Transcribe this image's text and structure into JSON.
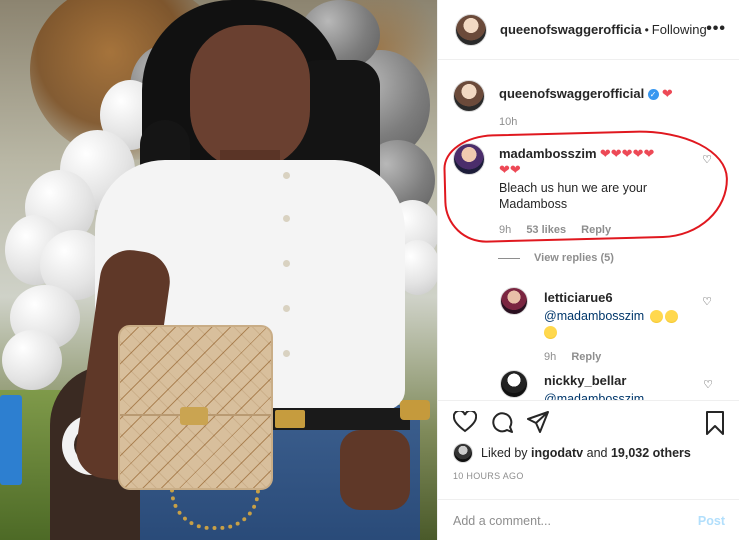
{
  "header": {
    "username": "queenofswaggerofficial",
    "username_display": "queenofswaggerofficia",
    "separator": "•",
    "follow_status": "Following",
    "more_icon": "more-horizontal-icon"
  },
  "caption": {
    "username": "queenofswaggerofficial",
    "verified": true,
    "text": "❤",
    "time": "10h"
  },
  "comments": [
    {
      "username": "madambosszim",
      "text_hearts_line1": "❤❤❤❤❤",
      "text_hearts_line2": "❤❤",
      "text": "Bleach us hun we are your Madamboss",
      "time": "9h",
      "likes": "53 likes",
      "reply_label": "Reply",
      "view_replies": "View replies (5)"
    }
  ],
  "replies": [
    {
      "username": "letticiarue6",
      "mention": "@madambosszim",
      "time": "9h",
      "reply_label": "Reply"
    },
    {
      "username": "nickky_bellar",
      "mention": "@madambosszim"
    }
  ],
  "actions": {
    "liked_by_prefix": "Liked by",
    "liked_by_user": "ingodatv",
    "liked_by_and": "and",
    "liked_by_count": "19,032 others",
    "time_ago": "10 HOURS AGO",
    "comment_placeholder": "Add a comment...",
    "post_label": "Post"
  },
  "colors": {
    "annotation_circle": "#e0181f",
    "heart": "#ed4956",
    "verified": "#3897f0",
    "post_disabled": "#b2dffc"
  }
}
